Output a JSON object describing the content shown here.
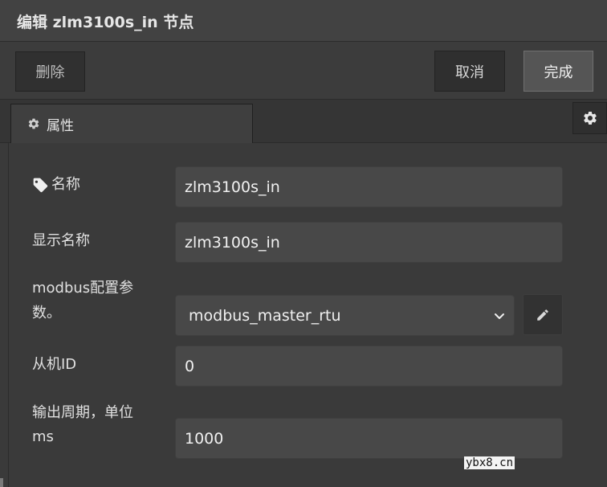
{
  "dialog": {
    "title": "编辑 zlm3100s_in 节点"
  },
  "toolbar": {
    "delete_label": "删除",
    "cancel_label": "取消",
    "done_label": "完成"
  },
  "tabs": [
    {
      "label": "属性",
      "icon": "gear-icon"
    }
  ],
  "settings_icon": "gear-icon",
  "form": {
    "name": {
      "label": "名称",
      "icon": "tag-icon",
      "value": "zlm3100s_in"
    },
    "display_name": {
      "label": "显示名称",
      "value": "zlm3100s_in"
    },
    "modbus_config": {
      "label_line1": "modbus配置参",
      "label_line2": "数。",
      "selected": "modbus_master_rtu",
      "edit_icon": "pencil-icon"
    },
    "slave_id": {
      "label": "从机ID",
      "value": "0"
    },
    "output_period": {
      "label_line1": "输出周期，单位",
      "label_line2": "ms",
      "value": "1000"
    }
  },
  "watermark": "ybx8.cn",
  "colors": {
    "background": "#3a3a3a",
    "input": "#484848",
    "done_button": "#555555"
  }
}
